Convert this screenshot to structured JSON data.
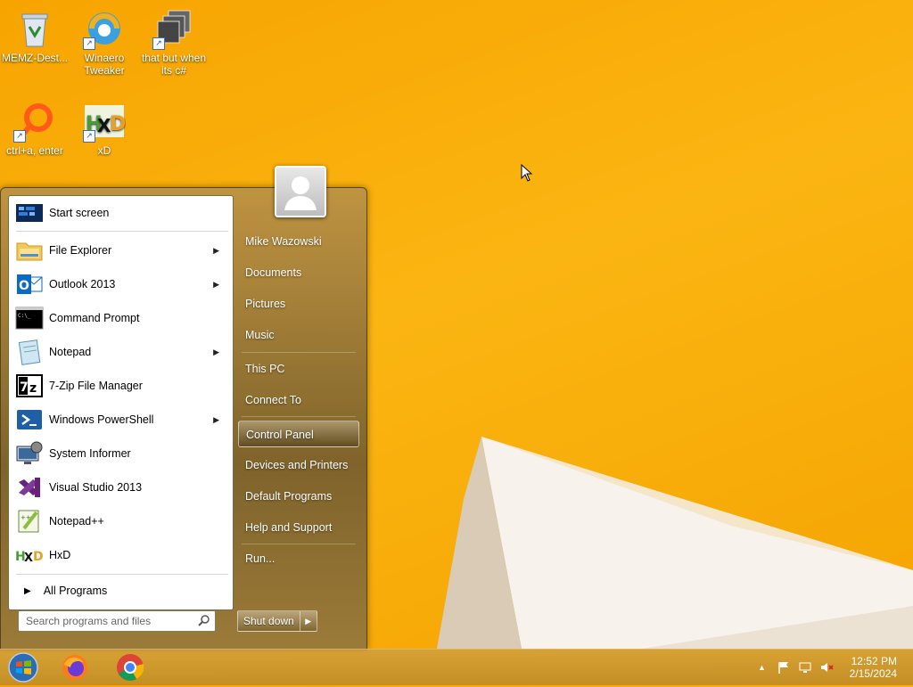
{
  "desktop": {
    "icons": [
      {
        "label": "MEMZ-Dest..."
      },
      {
        "label": "Winaero Tweaker"
      },
      {
        "label": "that but when its c#"
      },
      {
        "label": "ctrl+a, enter"
      },
      {
        "label": "xD"
      }
    ]
  },
  "start_menu": {
    "programs": [
      {
        "label": "Start screen",
        "icon": "start-screen-icon"
      },
      {
        "label": "File Explorer",
        "icon": "folder-icon",
        "has_submenu": true
      },
      {
        "label": "Outlook 2013",
        "icon": "outlook-icon",
        "has_submenu": true
      },
      {
        "label": "Command Prompt",
        "icon": "command-prompt-icon"
      },
      {
        "label": "Notepad",
        "icon": "notepad-icon",
        "has_submenu": true
      },
      {
        "label": "7-Zip File Manager",
        "icon": "7zip-icon"
      },
      {
        "label": "Windows PowerShell",
        "icon": "powershell-icon",
        "has_submenu": true
      },
      {
        "label": "System Informer",
        "icon": "system-informer-icon"
      },
      {
        "label": "Visual Studio 2013",
        "icon": "visual-studio-icon"
      },
      {
        "label": "Notepad++",
        "icon": "notepadpp-icon"
      },
      {
        "label": "HxD",
        "icon": "hxd-icon"
      }
    ],
    "all_programs": "All Programs",
    "search_placeholder": "Search programs and files",
    "right_links": [
      "Mike Wazowski",
      "Documents",
      "Pictures",
      "Music",
      "This PC",
      "Connect To",
      "Control Panel",
      "Devices and Printers",
      "Default Programs",
      "Help and Support",
      "Run..."
    ],
    "selected_link": "Control Panel",
    "shutdown_label": "Shut down"
  },
  "taskbar": {
    "pinned": [
      "start-orb-icon",
      "firefox-icon",
      "chrome-icon"
    ],
    "time": "12:52 PM",
    "date": "2/15/2024"
  },
  "colors": {
    "wallpaper": "#fbb512",
    "taskbar": "#c8962e",
    "accent_blue": "#1f5fb8"
  }
}
